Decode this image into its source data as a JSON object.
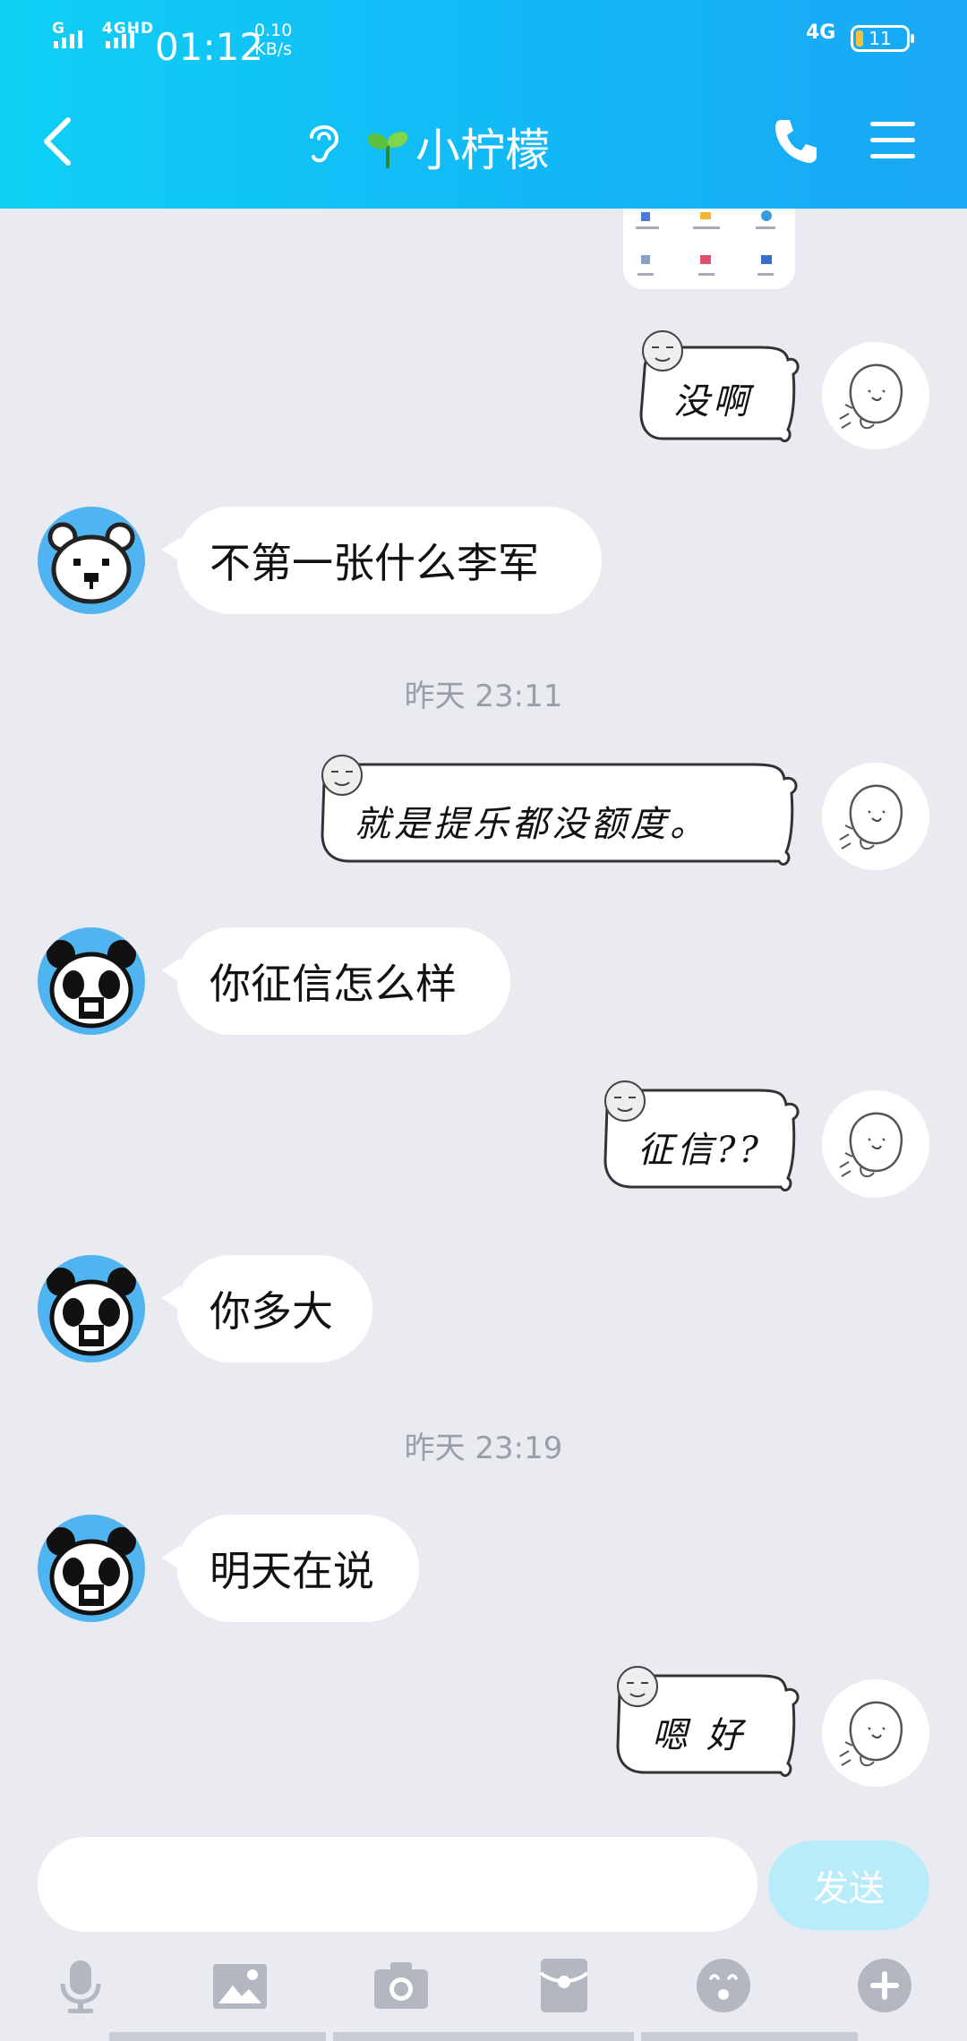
{
  "status_bar": {
    "signal_label": "G",
    "signal_label2": "4GHD",
    "time": "01:12",
    "speed_value": "0.10",
    "speed_unit": "KB/s",
    "network": "4G",
    "battery": "11"
  },
  "header": {
    "title": "小柠檬",
    "back_icon": "chevron-left-icon",
    "ear_icon": "ear-icon",
    "sprout_icon": "sprout-icon",
    "phone_icon": "phone-icon",
    "menu_icon": "menu-icon"
  },
  "messages": [
    {
      "side": "right",
      "type": "sticker",
      "text": "没啊"
    },
    {
      "side": "left",
      "type": "text",
      "text": "不第一张什么李军"
    },
    {
      "type": "timestamp",
      "text": "昨天 23:11"
    },
    {
      "side": "right",
      "type": "sticker",
      "text": "就是提乐都没额度。"
    },
    {
      "side": "left",
      "type": "text",
      "text": "你征信怎么样"
    },
    {
      "side": "right",
      "type": "sticker",
      "text": "征信??"
    },
    {
      "side": "left",
      "type": "text",
      "text": "你多大"
    },
    {
      "type": "timestamp",
      "text": "昨天 23:19"
    },
    {
      "side": "left",
      "type": "text",
      "text": "明天在说"
    },
    {
      "side": "right",
      "type": "sticker",
      "text": "嗯 好"
    }
  ],
  "input": {
    "placeholder": "",
    "value": ""
  },
  "send_label": "发送",
  "toolbar": [
    "microphone-icon",
    "image-icon",
    "camera-icon",
    "red-packet-icon",
    "emoji-icon",
    "plus-icon"
  ],
  "colors": {
    "header": "#12b8f6",
    "background": "#e9ebf1",
    "send_disabled": "#b8ecfb",
    "avatar_bg": "#4fb4ef"
  }
}
